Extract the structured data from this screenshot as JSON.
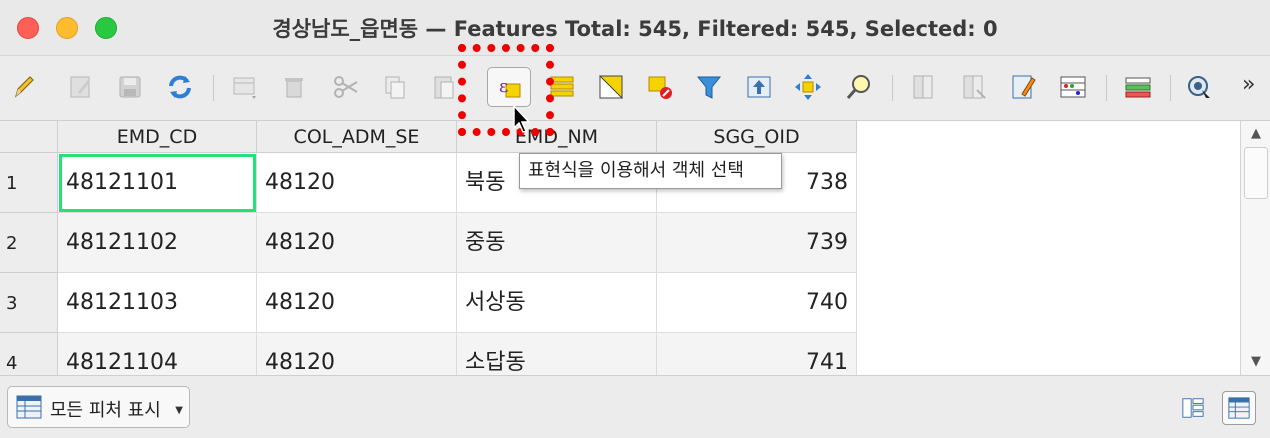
{
  "window": {
    "title": "경상남도_읍면동 — Features Total: 545, Filtered: 545, Selected: 0"
  },
  "toolbar": {
    "buttons": [
      {
        "icon": "pencil-icon",
        "label": "Toggle editing mode",
        "enabled": true
      },
      {
        "icon": "edit-multiple-icon",
        "label": "Toggle multi edit mode",
        "enabled": false
      },
      {
        "icon": "save-edits-icon",
        "label": "Save edits",
        "enabled": false
      },
      {
        "icon": "reload-icon",
        "label": "Reload the table",
        "enabled": true
      },
      {
        "icon": "add-feature-icon",
        "label": "Add feature",
        "enabled": false
      },
      {
        "icon": "delete-icon",
        "label": "Delete selected features",
        "enabled": false
      },
      {
        "icon": "cut-icon",
        "label": "Cut",
        "enabled": false
      },
      {
        "icon": "copy-icon",
        "label": "Copy",
        "enabled": false
      },
      {
        "icon": "paste-icon",
        "label": "Paste",
        "enabled": false
      },
      {
        "icon": "select-by-expression-icon",
        "label": "표현식을 이용해서 객체 선택",
        "enabled": true,
        "active": true
      },
      {
        "icon": "select-all-icon",
        "label": "Select all",
        "enabled": true
      },
      {
        "icon": "invert-selection-icon",
        "label": "Invert selection",
        "enabled": true
      },
      {
        "icon": "deselect-icon",
        "label": "Deselect all",
        "enabled": true
      },
      {
        "icon": "filter-icon",
        "label": "Filter",
        "enabled": true
      },
      {
        "icon": "move-to-top-icon",
        "label": "Move selection to top",
        "enabled": true
      },
      {
        "icon": "pan-to-selection-icon",
        "label": "Pan map to selection",
        "enabled": true
      },
      {
        "icon": "zoom-to-selection-icon",
        "label": "Zoom map to selection",
        "enabled": true
      },
      {
        "icon": "new-field-icon",
        "label": "New field",
        "enabled": false
      },
      {
        "icon": "delete-field-icon",
        "label": "Delete field",
        "enabled": false
      },
      {
        "icon": "field-calculator-icon",
        "label": "Field calculator",
        "enabled": true
      },
      {
        "icon": "conditional-formatting-icon",
        "label": "Conditional formatting",
        "enabled": true
      },
      {
        "icon": "dock-icon",
        "label": "Dock attribute table",
        "enabled": true
      },
      {
        "icon": "actions-icon",
        "label": "Actions",
        "enabled": true
      }
    ],
    "overflow_label": "»"
  },
  "tooltip": {
    "text": "표현식을 이용해서 객체 선택"
  },
  "table": {
    "columns": [
      "EMD_CD",
      "COL_ADM_SE",
      "EMD_NM",
      "SGG_OID"
    ],
    "rows": [
      {
        "row_num": "1",
        "EMD_CD": "48121101",
        "COL_ADM_SE": "48120",
        "EMD_NM": "북동",
        "SGG_OID": "738"
      },
      {
        "row_num": "2",
        "EMD_CD": "48121102",
        "COL_ADM_SE": "48120",
        "EMD_NM": "중동",
        "SGG_OID": "739"
      },
      {
        "row_num": "3",
        "EMD_CD": "48121103",
        "COL_ADM_SE": "48120",
        "EMD_NM": "서상동",
        "SGG_OID": "740"
      },
      {
        "row_num": "4",
        "EMD_CD": "48121104",
        "COL_ADM_SE": "48120",
        "EMD_NM": "소답동",
        "SGG_OID": "741"
      }
    ]
  },
  "bottom": {
    "filter_label": "모든 피처 표시",
    "view_modes": [
      "form-view-icon",
      "table-view-icon"
    ],
    "active_view": "table-view-icon"
  },
  "colors": {
    "highlight": "#ee0000",
    "focus_cell": "#22e07a"
  }
}
